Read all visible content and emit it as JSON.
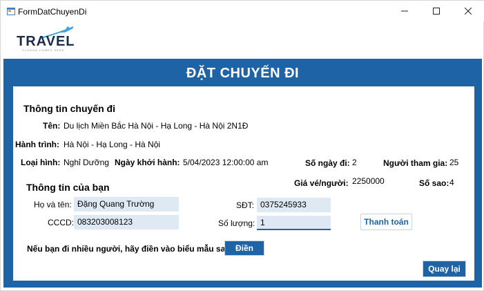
{
  "window": {
    "title": "FormDatChuyenDi",
    "minimize_icon": "minimize-icon",
    "maximize_icon": "maximize-icon",
    "close_icon": "close-icon"
  },
  "logo": {
    "text": "TRAVEL",
    "slogan": "SLOGAN COMES HERE",
    "icon": "airplane-icon"
  },
  "header": {
    "title": "ĐẶT CHUYẾN ĐI"
  },
  "trip_info": {
    "heading": "Thông tin chuyến đi",
    "name_label": "Tên:",
    "name_value": "Du lịch Miền Bắc Hà Nội - Hạ Long - Hà Nội 2N1Đ",
    "route_label": "Hành trình:",
    "route_value": "Hà Nội - Hạ Long - Hà Nội",
    "type_label": "Loại hình:",
    "type_value": "Nghỉ Dưỡng",
    "departure_label": "Ngày khởi hành:",
    "departure_value": "5/04/2023 12:00:00 am",
    "days_label": "Số ngày đi:",
    "days_value": "2",
    "participants_label": "Người tham gia:",
    "participants_value": "25",
    "price_label": "Giá vé/người:",
    "price_value": "2250000",
    "stars_label": "Số sao:",
    "stars_value": "4"
  },
  "your_info": {
    "heading": "Thông tin của bạn",
    "fullname_label": "Họ và tên:",
    "fullname_value": "Đặng Quang Trường",
    "phone_label": "SĐT:",
    "phone_value": "0375245933",
    "id_label": "CCCD:",
    "id_value": "083203008123",
    "quantity_label": "Số lượng:",
    "quantity_value": "1",
    "pay_button": "Thanh toán",
    "group_prompt": "Nếu bạn đi nhiều người, hãy điền vào biểu mẫu sau:",
    "fill_button": "Điền",
    "back_button": "Quay lại"
  },
  "colors": {
    "accent": "#1d63a6",
    "field_bg": "#dfe9f4"
  }
}
